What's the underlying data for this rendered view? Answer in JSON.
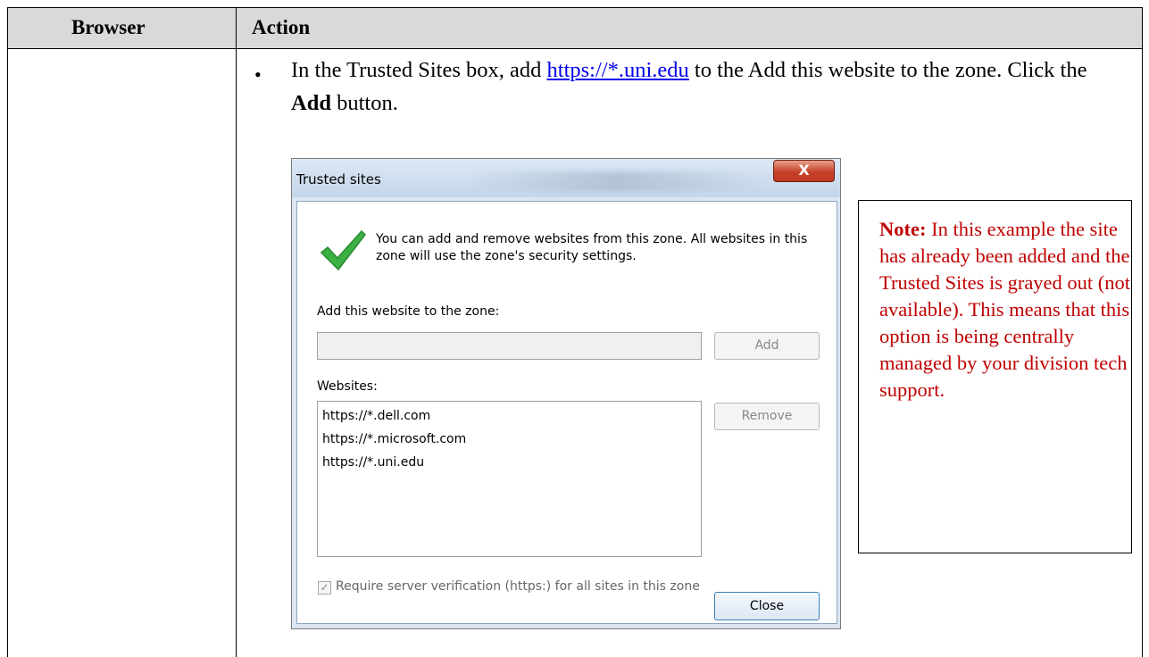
{
  "table": {
    "headers": [
      "Browser",
      "Action"
    ]
  },
  "instruction": {
    "bullet": "•",
    "prefix": "In the Trusted Sites box, add",
    "link_text": "https://*.uni.edu",
    "middle": "to the Add this website to the zone.  Click the",
    "bold_word": "Add",
    "suffix": "button."
  },
  "dialog": {
    "title": "Trusted sites",
    "close_glyph": "X",
    "description": "You can add and remove websites from this zone. All websites in this zone will use the zone's security settings.",
    "add_label": "Add this website to the zone:",
    "add_value": "",
    "add_button": "Add",
    "websites_label": "Websites:",
    "websites": [
      "https://*.dell.com",
      "https://*.microsoft.com",
      "https://*.uni.edu"
    ],
    "remove_button": "Remove",
    "checkbox_mark": "✓",
    "checkbox_label": "Require server verification (https:) for all sites in this zone",
    "close_button": "Close",
    "accent_color": "#3cb043"
  },
  "note": {
    "label": "Note:",
    "text": "In this example the site has already been added and the Trusted Sites is grayed out (not available).  This means that this option is being centrally managed by your division tech support.",
    "color": "#c00000"
  }
}
